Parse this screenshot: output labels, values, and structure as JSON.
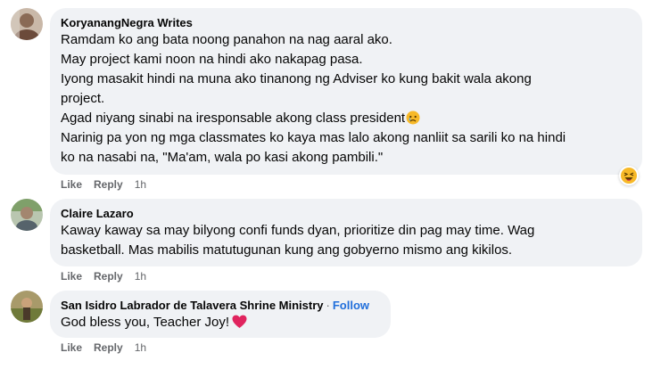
{
  "comments": [
    {
      "author": "KoryanangNegra Writes",
      "lines": [
        "Ramdam ko ang bata noong panahon na nag aaral ako.",
        "May project kami noon na hindi ako nakapag pasa.",
        "Iyong masakit hindi na muna ako tinanong ng Adviser ko kung bakit wala akong",
        "project.",
        "Agad niyang sinabi na iresponsable akong class president",
        "Narinig pa yon ng mga classmates ko kaya mas lalo akong nanliit sa sarili ko na hindi",
        "ko na nasabi na, \"Ma'am, wala po kasi akong pambili.\""
      ],
      "like": "Like",
      "reply": "Reply",
      "time": "1h",
      "reaction_icon": "haha-emoji-icon"
    },
    {
      "author": "Claire Lazaro",
      "lines": [
        "Kaway kaway sa may bilyong confi funds dyan, prioritize din pag may time. Wag",
        "basketball. Mas mabilis matutugunan kung ang gobyerno mismo ang kikilos."
      ],
      "like": "Like",
      "reply": "Reply",
      "time": "1h"
    },
    {
      "author": "San Isidro Labrador de Talavera Shrine Ministry",
      "separator": "·",
      "follow": "Follow",
      "lines": [
        "God bless you, Teacher Joy!"
      ],
      "like": "Like",
      "reply": "Reply",
      "time": "1h"
    }
  ],
  "colors": {
    "bubble": "#f0f2f5",
    "secondary_text": "#65676b",
    "follow_link": "#216fdb",
    "heart": "#e0245e"
  }
}
